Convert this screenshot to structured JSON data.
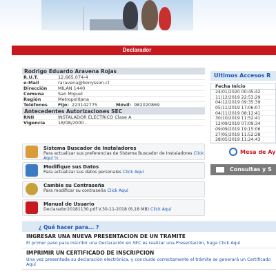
{
  "banner_title": "Declarador",
  "profile": {
    "name": "Rodrigo Eduardo Aravena Rojas",
    "rows": [
      {
        "label": "R.U.T.",
        "value": "12.665.074-4"
      },
      {
        "label": "e-Mail",
        "value": "raravena@bonysson.cl"
      },
      {
        "label": "Dirección",
        "value": "MILAN 1440"
      },
      {
        "label": "Comuna",
        "value": "San Miguel"
      },
      {
        "label": "Región",
        "value": "Metropolitana"
      }
    ],
    "phones_label": "Teléfonos",
    "fijo_label": "Fijo:",
    "fijo_value": "223142775",
    "movil_label": "Móvil:",
    "movil_value": "982020869"
  },
  "sec": {
    "title": "Antecedentes Autorizaciones SEC",
    "rows": [
      {
        "label": "RNII",
        "value": "INSTALADOR ELECTRICO Clase A"
      },
      {
        "label": "Vigencia",
        "value": "18/08/2000 -"
      }
    ]
  },
  "cards": [
    {
      "title": "Sistema Buscador de Instaladores",
      "desc": "Para actualizar sus preferencias de Sistema Buscador de Instaladores",
      "link": "Click Aquí ½"
    },
    {
      "title": "Modifique sus Datos",
      "desc": "Para actualizar sus datos personales",
      "link": "Click Aquí"
    },
    {
      "title": "Cambie su Contraseña",
      "desc": "Para modificar su contraseña",
      "link": "Click Aquí"
    },
    {
      "title": "Manual de Usuario",
      "desc": "Declarador20181130.pdf V.30-11-2018 (6,18 MB)",
      "link": "Click Aquí"
    }
  ],
  "accesos": {
    "title": "Ultimos Accesos R",
    "col_header": "Fecha Inicio",
    "rows": [
      "24/01/2020 00:45:42",
      "11/12/2019 22:53:29",
      "04/12/2019 09:35:39",
      "05/11/2019 17:06:07",
      "04/11/2019 08:12:41",
      "30/10/2019 11:52:41",
      "12/09/2019 07:09:34",
      "09/09/2019 19:15:06",
      "27/05/2019 11:52:28",
      "28/05/2019 11:24:43"
    ]
  },
  "mesa_label": "Mesa de Ay",
  "consultas_label": "Consultas y S",
  "que_hacer": {
    "title": "¿ Qué hacer para... ?",
    "items": [
      {
        "title": "INGRESAR UNA NUEVA PRESENTACION DE UN TRAMITE",
        "desc": "El primer paso para inscribir una Declaración en SEC es realizar una Presentación, haga",
        "link": "Click Aquí"
      },
      {
        "title": "IMPRIMIR UN CERTIFICADO DE INSCRIPCION",
        "desc": "Una vez presentada su declaración electrónica, y concluido correctamente el trámite se generará un Certificado",
        "link": "Aquí"
      }
    ]
  }
}
